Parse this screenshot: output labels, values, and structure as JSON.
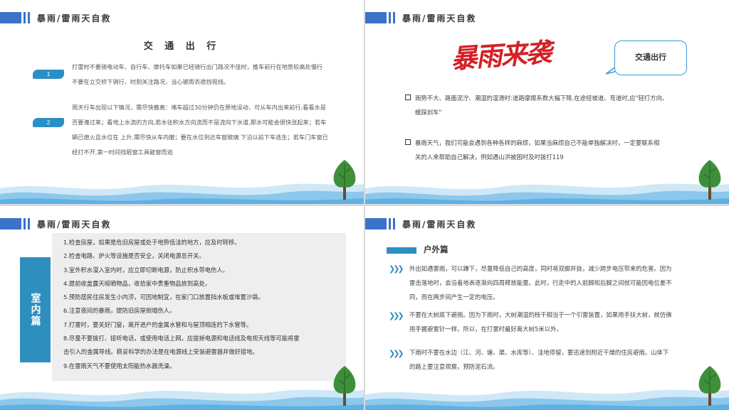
{
  "header_title": "暴雨/雷雨天自救",
  "slide1": {
    "title": "交 通 出 行",
    "items": [
      {
        "number": "1",
        "lines": [
          "打雷时不要骑电动车、自行车、摩托车如果已经骑行出门路况不佳时，推车前行在地势较高处慢行",
          "不要在立交桥下骑行，时刻关注路况，当心被雨衣遮挡视线。"
        ]
      },
      {
        "number": "2",
        "lines": [
          "雨天行车出现以下情况，需尽快撤离：堵车超过30分钟仍在原地没动，可从车内出来前行,看看水是",
          "否要淹过来；看地上水流的方向,若水往积水方向流而不是流向下水道,那水可能会很快涨起来；若车",
          "辆已熄火且水位在 上升,需尽快从车内撤；要在水位到达车窗玻璃 下沿以前下车逃生；若车门车窗已",
          "经打不开,第一时间找砸窗工具破窗而逃"
        ]
      }
    ]
  },
  "slide2": {
    "logo_text": "暴雨来袭",
    "callout_label": "交通出行",
    "bullets": [
      {
        "lines": [
          "雨势不大、路面泥泞、潮湿的湿滑时:道路摩擦系数大幅下降,在途经坡道、弯道时,应\"轻打方向、",
          "缓踩刹车\""
        ]
      },
      {
        "lines": [
          "暴雨天气，我们可能会遇到各种各样的麻烦，如果当麻烦自己不能单独解决时，一定要联系相",
          "关的人来帮助自己解决，例如遇山洪被困时及时拨打119"
        ]
      }
    ]
  },
  "slide3": {
    "tab_label": "室内篇",
    "items": [
      "1.检查房屋，如果是危旧房屋或处于地势低洼的地方，应及时转移。",
      "2.检查电路、炉火等设施是否安全，关闭电源总开关。",
      "3.室外积水漫入室内时，应立即切断电源，防止积水带电伤人。",
      "4.提前收盖露天晾晒物品，收拾家中贵重物品放到高处。",
      "5.预防居民住房发生小内涝，可因地制宜，在家门口放置挡水板或堆置沙袋。",
      "6.注意夜间的暴雨，提防旧房屋倒塌伤人。",
      "7.打雷时，要关好门窗，离开进户的金属水管和与屋顶相连的下水管等。",
      "8.尽量不要拨打、接听电话，或使用电话上网，应拔掉电源和电话线及电视天线等可能将雷",
      "击引入的金属导线。稳妥科学的办法是在电源线上安装避雷器并做好接地。",
      "9.在雷雨天气不要使用太阳能热水器洗澡。"
    ]
  },
  "slide4": {
    "section_title": "户外篇",
    "items": [
      {
        "lines": [
          "外出如遇雷雨，可以蹲下，尽量降低自己的高度，同时将双脚并拢，减少跨步电压带来的危害。因为",
          "雷击落地时，会沿着地表逐渐向四周释放能量。此时，行走中的人前脚和后脚之间就可能因电位差不",
          "同，而在两步间产生一定的电压。"
        ]
      },
      {
        "lines": [
          "不要在大树底下避雨。因为下雨时，大树潮湿的枝干相当于一个引雷装置，如果用手扶大树，就仿佛",
          "用手握避雷针一样。所以，在打雷时最好离大树5米以外。"
        ]
      },
      {
        "lines": [
          "下雨时不要在水边（江、河、塘、渠、水库等）、洼地停留，要迅速到附近干燥的住房避雨。山体下",
          "的路上要注意观察，预防泥石流。"
        ]
      }
    ]
  },
  "colors": {
    "accent_blue": "#2b8fc4",
    "header_blue": "#3a73c9",
    "logo_red": "#d42026",
    "wave_light": "#cfe8f7",
    "wave_mid": "#8cc7ec",
    "tree_green": "#3f8f3a"
  }
}
